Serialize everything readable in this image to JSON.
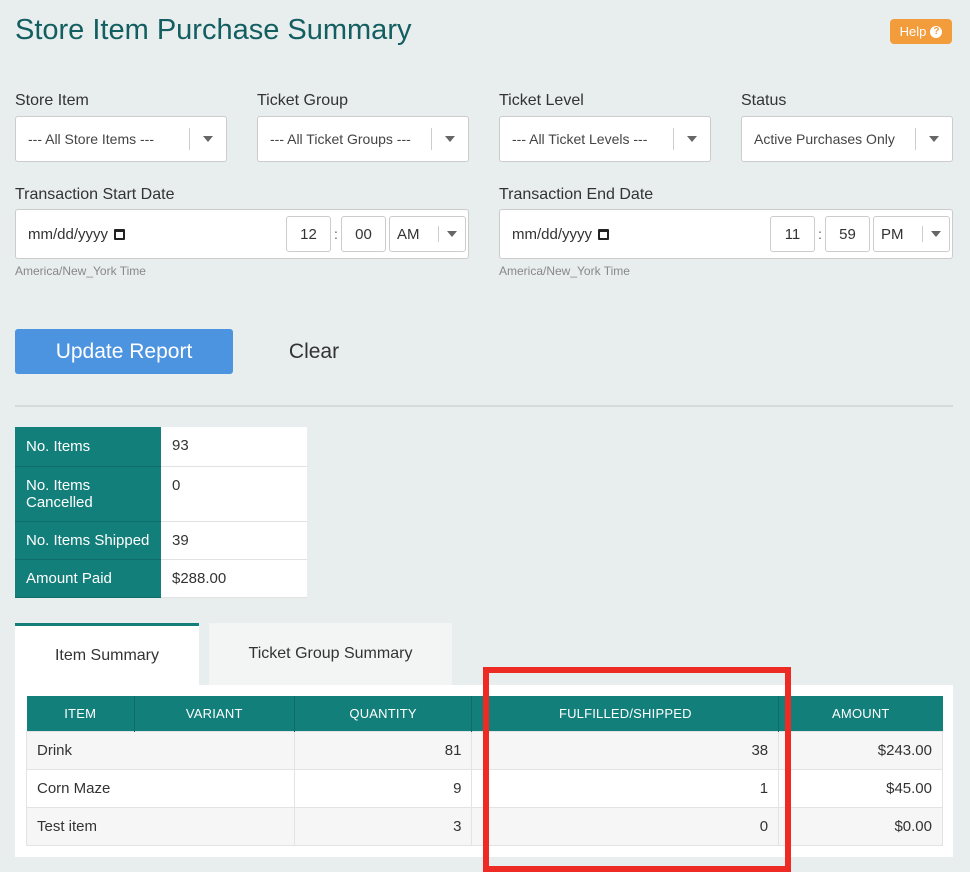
{
  "page": {
    "title": "Store Item Purchase Summary",
    "help_label": "Help",
    "help_icon": "?"
  },
  "filters": {
    "store_item": {
      "label": "Store Item",
      "value": "--- All Store Items ---"
    },
    "ticket_group": {
      "label": "Ticket Group",
      "value": "--- All Ticket Groups ---"
    },
    "ticket_level": {
      "label": "Ticket Level",
      "value": "--- All Ticket Levels ---"
    },
    "status": {
      "label": "Status",
      "value": "Active Purchases Only"
    },
    "start": {
      "label": "Transaction Start Date",
      "date_placeholder": "mm/dd/yyyy",
      "hour": "12",
      "minute": "00",
      "ampm": "AM",
      "timezone": "America/New_York Time"
    },
    "end": {
      "label": "Transaction End Date",
      "date_placeholder": "mm/dd/yyyy",
      "hour": "11",
      "minute": "59",
      "ampm": "PM",
      "timezone": "America/New_York Time"
    },
    "colon": ":"
  },
  "actions": {
    "update_label": "Update Report",
    "clear_label": "Clear"
  },
  "stats": [
    {
      "label": "No. Items",
      "value": "93"
    },
    {
      "label": "No. Items Cancelled",
      "value": "0"
    },
    {
      "label": "No. Items Shipped",
      "value": "39"
    },
    {
      "label": "Amount Paid",
      "value": "$288.00"
    }
  ],
  "tabs": [
    {
      "label": "Item Summary",
      "active": true
    },
    {
      "label": "Ticket Group Summary",
      "active": false
    }
  ],
  "table": {
    "columns": [
      "ITEM",
      "VARIANT",
      "QUANTITY",
      "FULFILLED/SHIPPED",
      "AMOUNT"
    ],
    "rows": [
      {
        "item": "Drink",
        "variant": "",
        "quantity": "81",
        "fulfilled": "38",
        "amount": "$243.00"
      },
      {
        "item": "Corn Maze",
        "variant": "",
        "quantity": "9",
        "fulfilled": "1",
        "amount": "$45.00"
      },
      {
        "item": "Test item",
        "variant": "",
        "quantity": "3",
        "fulfilled": "0",
        "amount": "$0.00"
      }
    ]
  },
  "colors": {
    "title": "#135e60",
    "accent_teal": "#137f7b",
    "primary_button": "#4c93e0",
    "help_button": "#f39c3c",
    "highlight_box": "#ee2a24"
  }
}
